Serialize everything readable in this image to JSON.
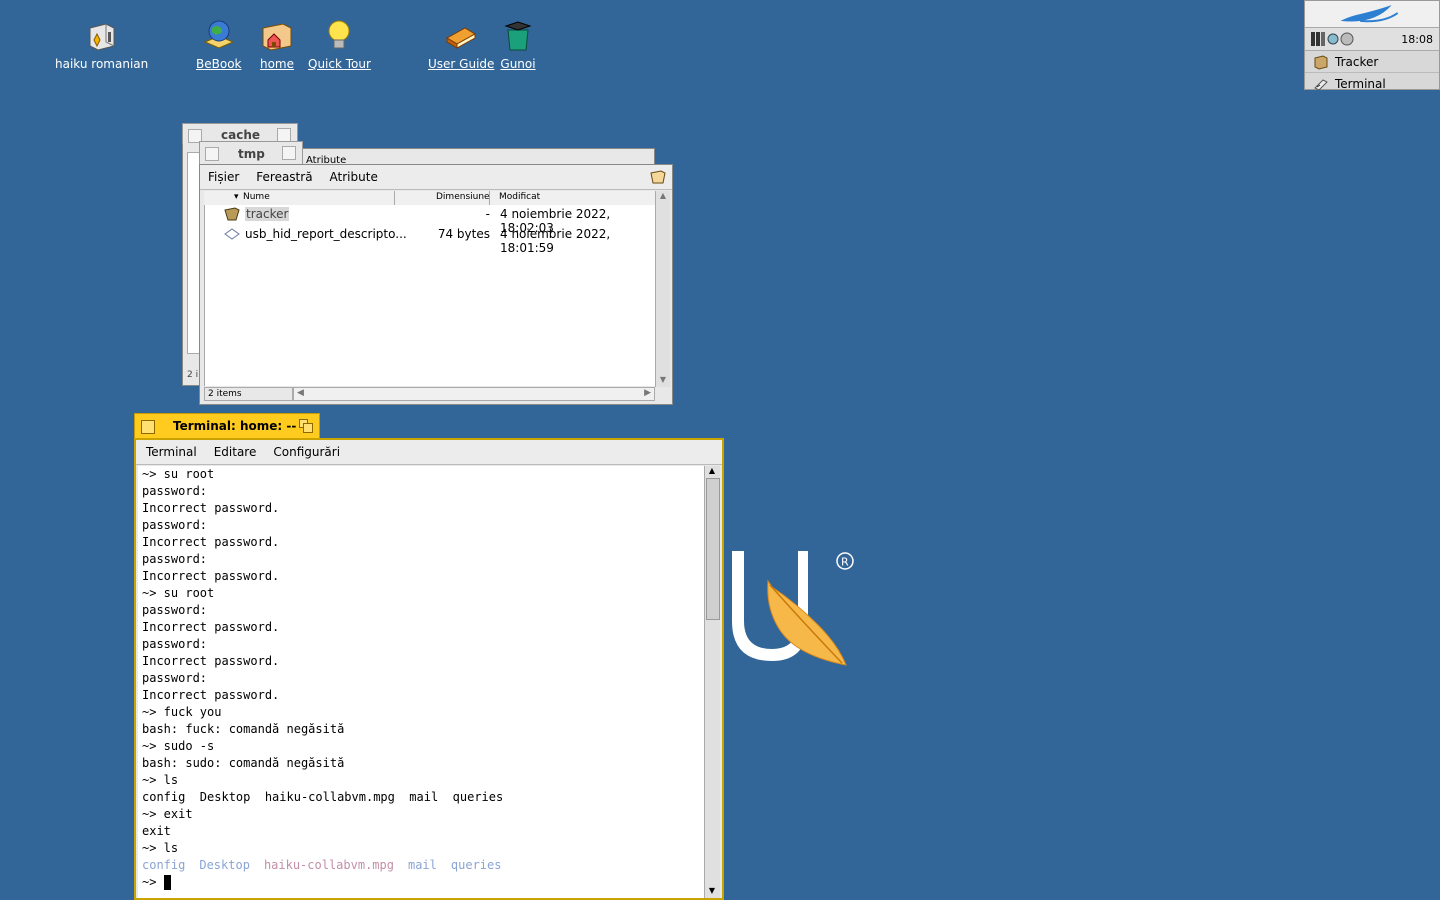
{
  "desktop_icons": [
    {
      "label": "haiku romanian",
      "underline": false
    },
    {
      "label": "BeBook",
      "underline": true
    },
    {
      "label": "home",
      "underline": true
    },
    {
      "label": "Quick Tour",
      "underline": true
    },
    {
      "label": "User Guide",
      "underline": true
    },
    {
      "label": "Gunoi",
      "underline": true
    }
  ],
  "deskbar": {
    "clock": "18:08",
    "apps": [
      "Tracker",
      "Terminal"
    ]
  },
  "back_windows": {
    "cache_title": "cache",
    "tmp_title": "tmp",
    "attr_fragment": "Atribute",
    "cache_status_fragment": "2 i"
  },
  "tracker": {
    "menu": [
      "Fișier",
      "Fereastră",
      "Atribute"
    ],
    "columns": {
      "name": "Nume",
      "size": "Dimensiune",
      "modified": "Modificat"
    },
    "files": [
      {
        "name": "tracker",
        "size": "-",
        "modified": "4 noiembrie 2022, 18:02:03",
        "icon": "folder-query-icon"
      },
      {
        "name": "usb_hid_report_descripto...",
        "size": "74 bytes",
        "modified": "4 noiembrie 2022, 18:01:59",
        "icon": "file-icon"
      }
    ],
    "status": "2 items"
  },
  "terminal": {
    "title": "Terminal: home: --",
    "menu": [
      "Terminal",
      "Editare",
      "Configurări"
    ],
    "lines": [
      "~> su root",
      "password:",
      "Incorrect password.",
      "password:",
      "Incorrect password.",
      "password:",
      "Incorrect password.",
      "~> su root",
      "password:",
      "Incorrect password.",
      "password:",
      "Incorrect password.",
      "password:",
      "Incorrect password.",
      "~> fuck you",
      "bash: fuck: comandă negăsită",
      "~> sudo -s",
      "bash: sudo: comandă negăsită",
      "~> ls",
      "config  Desktop  haiku-collabvm.mpg  mail  queries",
      "~> exit",
      "exit",
      "~> ls"
    ],
    "ls_colored": [
      {
        "text": "config",
        "color": "#8aa4d6"
      },
      {
        "text": "Desktop",
        "color": "#8aa4d6"
      },
      {
        "text": "haiku-collabvm.mpg",
        "color": "#c38fa8"
      },
      {
        "text": "mail",
        "color": "#8aa4d6"
      },
      {
        "text": "queries",
        "color": "#8aa4d6"
      }
    ],
    "prompt": "~> "
  }
}
